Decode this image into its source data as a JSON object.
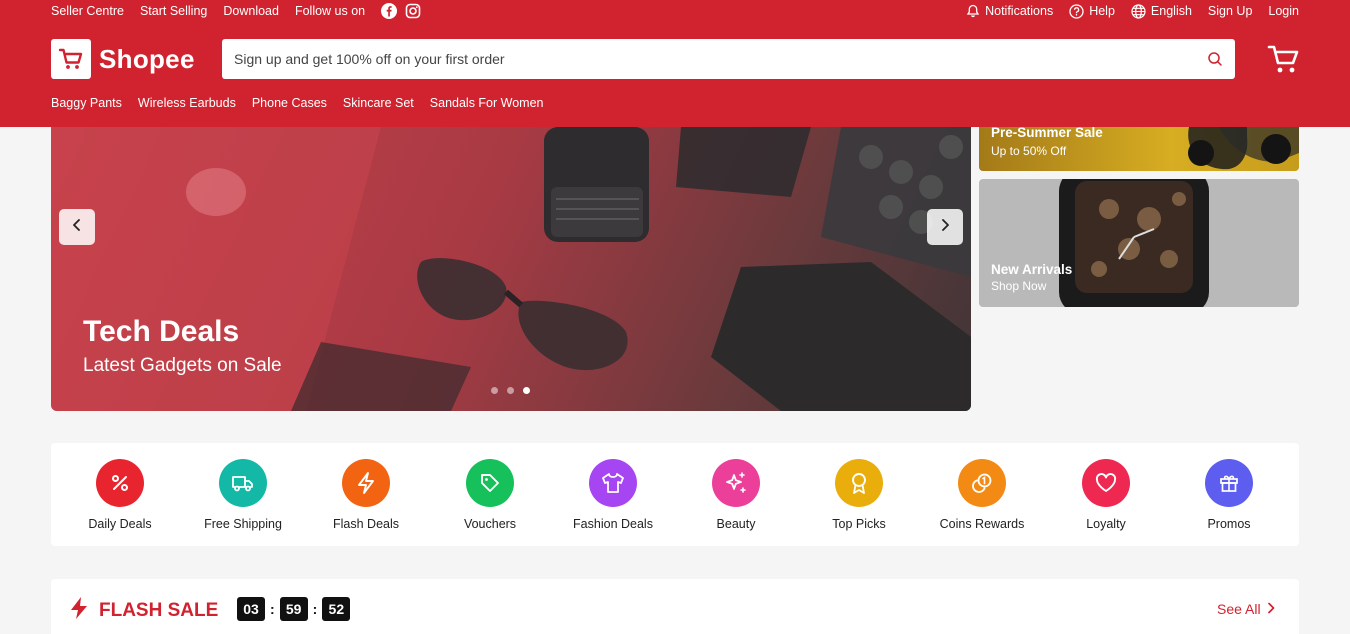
{
  "topbar": {
    "seller_centre": "Seller Centre",
    "start_selling": "Start Selling",
    "download": "Download",
    "follow_us": "Follow us on",
    "notifications": "Notifications",
    "help": "Help",
    "language": "English",
    "sign_up": "Sign Up",
    "login": "Login"
  },
  "brand": {
    "name": "Shopee",
    "color": "#d0232f"
  },
  "search": {
    "placeholder": "Sign up and get 100% off on your first order"
  },
  "suggestions": [
    "Baggy Pants",
    "Wireless Earbuds",
    "Phone Cases",
    "Skincare Set",
    "Sandals For Women"
  ],
  "banner": {
    "title": "Tech Deals",
    "subtitle": "Latest Gadgets on Sale",
    "slides": 3,
    "active_slide": 3
  },
  "side_banners": [
    {
      "title": "Pre-Summer Sale",
      "subtitle": "Up to 50% Off"
    },
    {
      "title": "New Arrivals",
      "subtitle": "Shop Now"
    }
  ],
  "categories": [
    {
      "label": "Daily Deals",
      "color": "#e8242e",
      "icon": "percent-icon"
    },
    {
      "label": "Free Shipping",
      "color": "#14b8a6",
      "icon": "truck-icon"
    },
    {
      "label": "Flash Deals",
      "color": "#f26411",
      "icon": "bolt-icon"
    },
    {
      "label": "Vouchers",
      "color": "#16c05a",
      "icon": "tag-icon"
    },
    {
      "label": "Fashion Deals",
      "color": "#a646f2",
      "icon": "shirt-icon"
    },
    {
      "label": "Beauty",
      "color": "#ec3f9a",
      "icon": "sparkle-icon"
    },
    {
      "label": "Top Picks",
      "color": "#e9ad0c",
      "icon": "award-icon"
    },
    {
      "label": "Coins Rewards",
      "color": "#f38a14",
      "icon": "coins-icon"
    },
    {
      "label": "Loyalty",
      "color": "#ef2851",
      "icon": "heart-icon"
    },
    {
      "label": "Promos",
      "color": "#5d5ef0",
      "icon": "gift-icon"
    }
  ],
  "flash_sale": {
    "title": "FLASH SALE",
    "timer": {
      "hours": "03",
      "minutes": "59",
      "seconds": "52"
    },
    "see_all": "See All"
  }
}
